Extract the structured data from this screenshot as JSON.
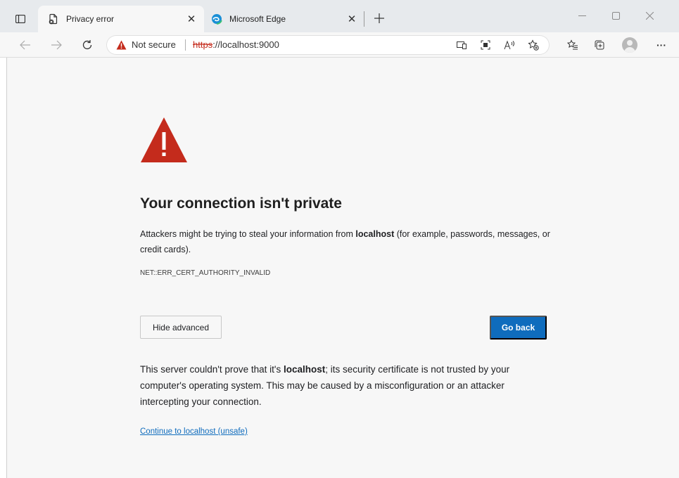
{
  "tabs": [
    {
      "title": "Privacy error",
      "favicon": "page-error-icon",
      "active": true
    },
    {
      "title": "Microsoft Edge",
      "favicon": "edge-logo-icon",
      "active": false
    }
  ],
  "address_bar": {
    "security_label": "Not secure",
    "url_scheme": "https",
    "url_rest": "://localhost:9000"
  },
  "error_page": {
    "heading": "Your connection isn't private",
    "description_part1": "Attackers might be trying to steal your information from ",
    "description_host": "localhost",
    "description_part2": " (for example, passwords, messages, or credit cards).",
    "error_code": "NET::ERR_CERT_AUTHORITY_INVALID",
    "hide_advanced_label": "Hide advanced",
    "go_back_label": "Go back",
    "details_part1": "This server couldn't prove that it's ",
    "details_host": "localhost",
    "details_part2": "; its security certificate is not trusted by your computer's operating system. This may be caused by a misconfiguration or an attacker intercepting your connection.",
    "proceed_link": "Continue to localhost (unsafe)"
  },
  "colors": {
    "warning_red": "#c42b1c",
    "accent_blue": "#0f6cbd",
    "page_background": "#f7f7f7"
  },
  "icons": [
    "tab-actions-icon",
    "page-error-icon",
    "edge-logo-icon",
    "close-icon",
    "new-tab-icon",
    "minimize-icon",
    "maximize-icon",
    "window-close-icon",
    "back-arrow-icon",
    "forward-arrow-icon",
    "refresh-icon",
    "warning-icon",
    "app-available-icon",
    "immersive-reader-icon",
    "read-aloud-icon",
    "add-favorite-icon",
    "favorites-icon",
    "collections-icon",
    "profile-icon",
    "more-icon"
  ]
}
